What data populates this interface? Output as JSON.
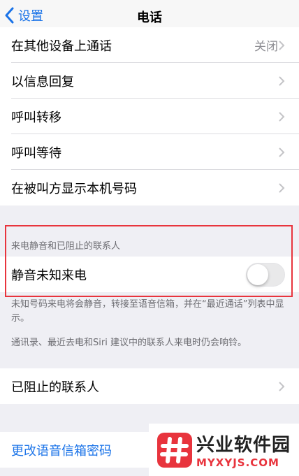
{
  "nav": {
    "back_label": "设置",
    "title": "电话"
  },
  "group1": [
    {
      "label": "在其他设备上通话",
      "value": "关闭"
    },
    {
      "label": "以信息回复"
    },
    {
      "label": "呼叫转移"
    },
    {
      "label": "呼叫等待"
    },
    {
      "label": "在被叫方显示本机号码"
    }
  ],
  "silence": {
    "header": "来电静音和已阻止的联系人",
    "label": "静音未知来电",
    "enabled": false,
    "note1": "未知号码来电将会静音，转接至语音信箱，并在“最近通话”列表中显示。",
    "note2": "通讯录、最近去电和Siri 建议中的联系人来电时仍会响铃。"
  },
  "blocked": {
    "label": "已阻止的联系人"
  },
  "voicemail": {
    "label": "更改语音信箱密码"
  },
  "watermark": {
    "cn": "兴业软件园",
    "en": "MYXYJS.COM"
  },
  "colors": {
    "accent": "#1a73e8",
    "highlight": "#e8343d"
  }
}
